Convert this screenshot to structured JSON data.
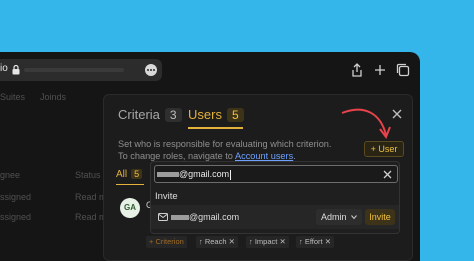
{
  "browser": {
    "url_partial": "io",
    "background_nav": [
      "Suites",
      "Joinds"
    ],
    "background_rows": [
      {
        "col1": "gnee",
        "col2": "Status"
      },
      {
        "col1": "ssigned",
        "col2": "Read m"
      },
      {
        "col1": "ssigned",
        "col2": "Read m"
      }
    ]
  },
  "modal": {
    "tabs": [
      {
        "label": "Criteria",
        "count": "3"
      },
      {
        "label": "Users",
        "count": "5"
      }
    ],
    "description_text": "Set who is responsible for evaluating which criterion. To change roles, navigate to",
    "description_link": "Account users",
    "description_end": ".",
    "add_user_label": "User",
    "subtab": {
      "label": "All",
      "count": "5"
    },
    "row": {
      "avatar_initials": "GA",
      "name_initial": "G"
    },
    "tags": [
      "Criterion",
      "Reach",
      "Impact",
      "Effort"
    ]
  },
  "dropdown": {
    "search_value": "@gmail.com",
    "section_title": "Invite",
    "invite_email": "@gmail.com",
    "role": "Admin",
    "invite_button": "Invite"
  },
  "colors": {
    "desktop": "#35b6ea",
    "accent": "#e3b13c",
    "annotation_arrow": "#e8434b",
    "link": "#6ea0ff"
  }
}
